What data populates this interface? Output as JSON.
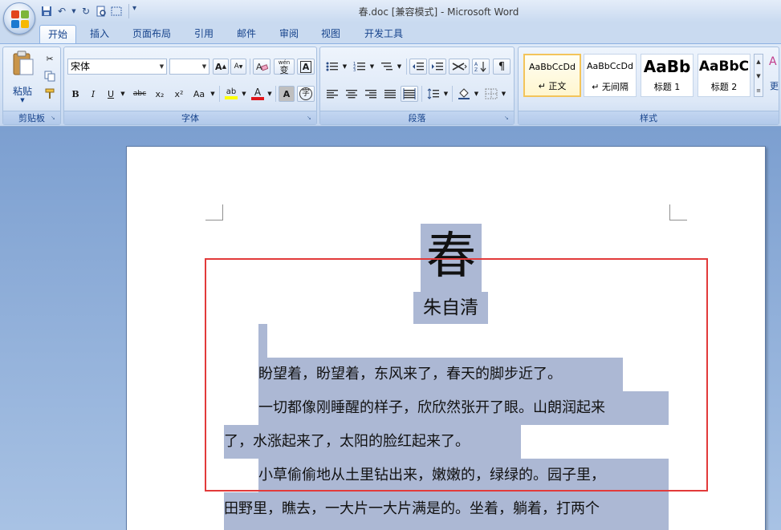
{
  "window": {
    "title": "春.doc [兼容模式] - Microsoft Word"
  },
  "tabs": [
    {
      "label": "开始",
      "active": true
    },
    {
      "label": "插入"
    },
    {
      "label": "页面布局"
    },
    {
      "label": "引用"
    },
    {
      "label": "邮件"
    },
    {
      "label": "审阅"
    },
    {
      "label": "视图"
    },
    {
      "label": "开发工具"
    }
  ],
  "clipboard": {
    "paste_label": "粘贴",
    "group_label": "剪贴板"
  },
  "font": {
    "font_name": "宋体",
    "font_size": "",
    "group_label": "字体",
    "buttons": {
      "bold": "B",
      "italic": "I",
      "underline": "U",
      "strike": "abc",
      "subscript": "x₂",
      "superscript": "x²",
      "change_case": "Aa",
      "highlight": "ab",
      "font_color": "A",
      "char_shading": "A",
      "enclose": "字",
      "grow": "A",
      "shrink": "A",
      "clear": "A",
      "phonetic": "wén",
      "char_border": "A"
    }
  },
  "paragraph": {
    "group_label": "段落"
  },
  "styles": {
    "group_label": "样式",
    "items": [
      {
        "sample": "AaBbCcDd",
        "name": "↵ 正文"
      },
      {
        "sample": "AaBbCcDd",
        "name": "↵ 无间隔"
      },
      {
        "sample": "AaBb",
        "name": "标题 1"
      },
      {
        "sample": "AaBbC",
        "name": "标题 2"
      }
    ],
    "change_styles_label": "更"
  },
  "document": {
    "title": "春",
    "author": "朱自清",
    "lines": [
      "盼望着，盼望着，东风来了，春天的脚步近了。",
      "一切都像刚睡醒的样子，欣欣然张开了眼。山朗润起来",
      "了，水涨起来了，太阳的脸红起来了。",
      "小草偷偷地从土里钻出来，嫩嫩的，绿绿的。园子里，",
      "田野里，瞧去，一大片一大片满是的。坐着，躺着，打两个"
    ]
  },
  "colors": {
    "highlight": "#acb8d4",
    "annotation_box": "#e23a3a",
    "ribbon_text": "#15428b"
  }
}
